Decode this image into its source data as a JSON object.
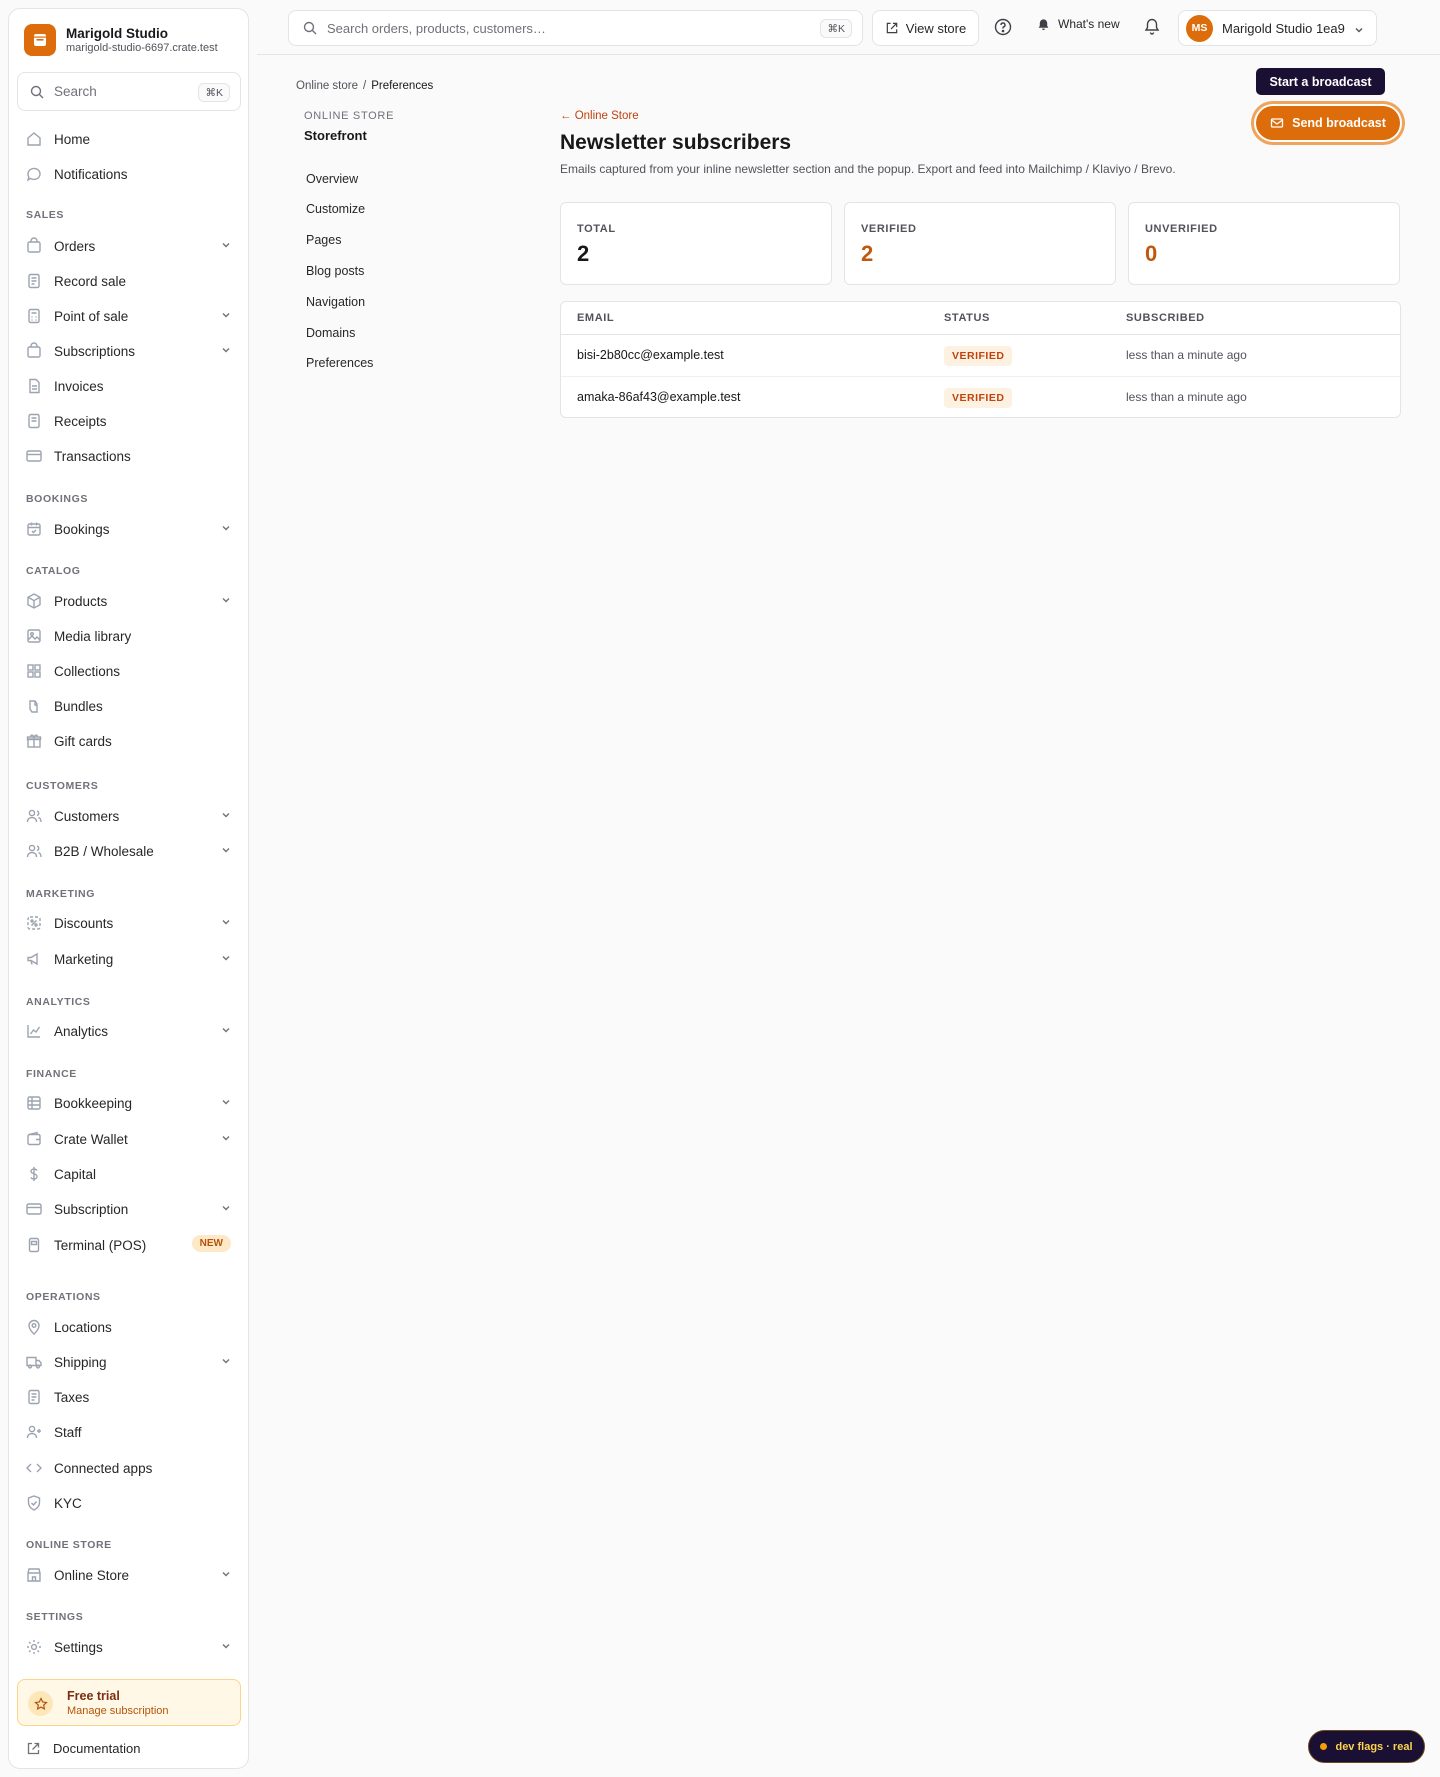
{
  "brand": {
    "name": "Marigold Studio",
    "domain": "marigold-studio-6697.crate.test"
  },
  "sidebar": {
    "search_label": "Search",
    "search_shortcut": "⌘K",
    "items": {
      "home": "Home",
      "notifications": "Notifications",
      "orders": "Orders",
      "record_sale": "Record sale",
      "point_of_sale": "Point of sale",
      "subscriptions": "Subscriptions",
      "invoices": "Invoices",
      "receipts": "Receipts",
      "transactions": "Transactions",
      "bookings": "Bookings",
      "products": "Products",
      "media_library": "Media library",
      "collections": "Collections",
      "bundles": "Bundles",
      "gift_cards": "Gift cards",
      "customers": "Customers",
      "b2b": "B2B / Wholesale",
      "discounts": "Discounts",
      "marketing": "Marketing",
      "analytics": "Analytics",
      "bookkeeping": "Bookkeeping",
      "crate_wallet": "Crate Wallet",
      "capital": "Capital",
      "subscription": "Subscription",
      "terminal": "Terminal (POS)",
      "locations": "Locations",
      "shipping": "Shipping",
      "taxes": "Taxes",
      "staff": "Staff",
      "connected_apps": "Connected apps",
      "kyc": "KYC",
      "online_store": "Online Store",
      "settings": "Settings"
    },
    "sections": {
      "sales": "SALES",
      "bookings": "BOOKINGS",
      "catalog": "CATALOG",
      "customers": "CUSTOMERS",
      "marketing": "MARKETING",
      "analytics": "ANALYTICS",
      "finance": "FINANCE",
      "operations": "OPERATIONS",
      "online_store": "ONLINE STORE",
      "settings": "SETTINGS"
    },
    "new_badge": "NEW",
    "trial": {
      "title": "Free trial",
      "link": "Manage subscription"
    },
    "documentation": "Documentation"
  },
  "topbar": {
    "search_placeholder": "Search orders, products, customers…",
    "search_shortcut": "⌘K",
    "view_store": "View store",
    "whats_new": "What's new",
    "account_initials": "MS",
    "account_name": "Marigold Studio 1ea9"
  },
  "breadcrumb": {
    "parent": "Online store",
    "separator": "/",
    "current": "Preferences"
  },
  "subnav": {
    "eyebrow": "ONLINE STORE",
    "title": "Storefront",
    "items": [
      "Overview",
      "Customize",
      "Pages",
      "Blog posts",
      "Navigation",
      "Domains",
      "Preferences"
    ]
  },
  "page": {
    "back_link": "← Online Store",
    "title": "Newsletter subscribers",
    "description": "Emails captured from your inline newsletter section and the popup. Export and feed into Mailchimp / Klaviyo / Brevo.",
    "tooltip": "Start a broadcast",
    "send_button": "Send broadcast"
  },
  "stats": [
    {
      "label": "TOTAL",
      "value": "2",
      "color": "#18181b"
    },
    {
      "label": "VERIFIED",
      "value": "2",
      "color": "#c2570c"
    },
    {
      "label": "UNVERIFIED",
      "value": "0",
      "color": "#c2570c"
    }
  ],
  "table": {
    "headers": {
      "email": "EMAIL",
      "status": "STATUS",
      "subscribed": "SUBSCRIBED"
    },
    "rows": [
      {
        "email": "bisi-2b80cc@example.test",
        "status": "VERIFIED",
        "subscribed": "less than a minute ago"
      },
      {
        "email": "amaka-86af43@example.test",
        "status": "VERIFIED",
        "subscribed": "less than a minute ago"
      }
    ]
  },
  "dev_flags": "dev flags · real",
  "colors": {
    "accent": "#dd6d0b",
    "dark": "#1a1033"
  }
}
